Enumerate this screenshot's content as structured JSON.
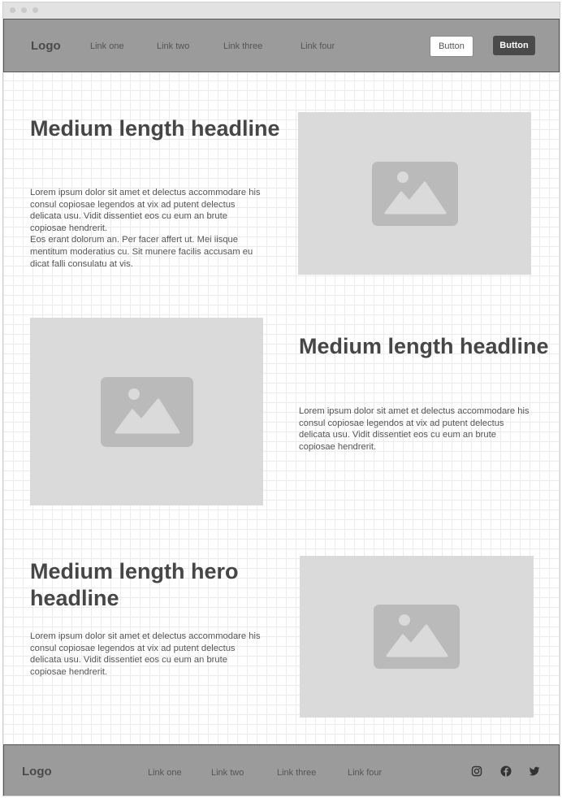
{
  "header": {
    "logo": "Logo",
    "links": [
      "Link one",
      "Link two",
      "Link three",
      "Link four"
    ],
    "button_secondary": "Button",
    "button_primary": "Button"
  },
  "sections": [
    {
      "headline": "Medium length headline",
      "body": "Lorem ipsum dolor sit amet et delectus accommodare his consul copiosae legendos at vix ad putent delectus delicata usu. Vidit dissentiet eos cu eum an brute copiosae hendrerit.\nEos erant dolorum an. Per facer affert ut. Mei iisque mentitum moderatius cu. Sit munere facilis accusam eu dicat falli consulatu at vis."
    },
    {
      "headline": "Medium length headline",
      "body": "Lorem ipsum dolor sit amet et delectus accommodare his consul copiosae legendos at vix ad putent delectus delicata usu. Vidit dissentiet eos cu eum an brute copiosae hendrerit."
    },
    {
      "headline": "Medium length hero headline",
      "body": "Lorem ipsum dolor sit amet et delectus accommodare his consul copiosae legendos at vix ad putent delectus delicata usu. Vidit dissentiet eos cu eum an brute copiosae hendrerit."
    }
  ],
  "footer": {
    "logo": "Logo",
    "links": [
      "Link one",
      "Link two",
      "Link three",
      "Link four"
    ],
    "social_icons": [
      "instagram-icon",
      "facebook-icon",
      "twitter-icon"
    ]
  },
  "colors": {
    "nav_background": "#9b9b9b",
    "primary_button": "#4a4a4a",
    "image_placeholder": "#dadada"
  }
}
